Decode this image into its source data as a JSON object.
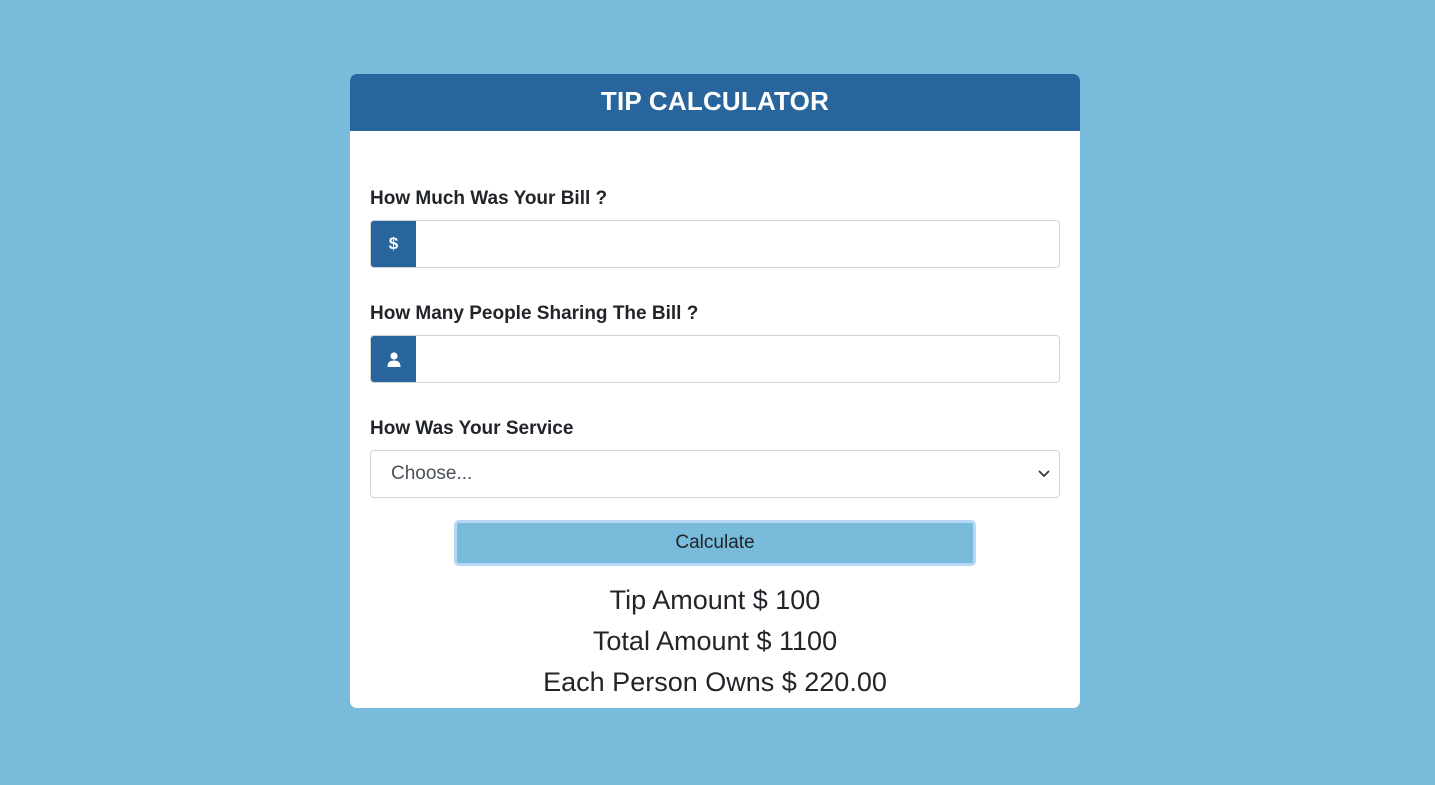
{
  "header": {
    "title": "TIP CALCULATOR"
  },
  "form": {
    "bill_label": "How Much Was Your Bill ?",
    "bill_addon": "$",
    "bill_value": "",
    "people_label": "How Many People Sharing The Bill ?",
    "people_addon_icon": "person-icon",
    "people_value": "",
    "service_label": "How Was Your Service",
    "service_selected": "Choose...",
    "calculate_label": "Calculate"
  },
  "results": {
    "tip_line": "Tip Amount $ 100",
    "total_line": "Total Amount $ 1100",
    "each_line": "Each Person Owns $ 220.00"
  },
  "colors": {
    "background": "#78bbdb",
    "header": "#28659c",
    "button": "#78bbdb"
  }
}
